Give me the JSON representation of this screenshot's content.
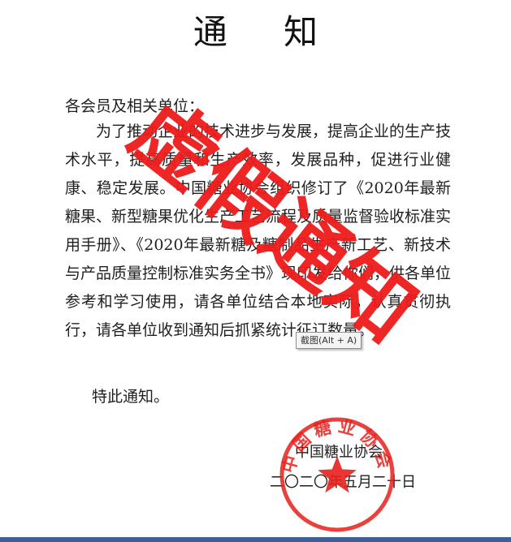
{
  "document": {
    "title": "通 知",
    "salutation": "各会员及相关单位：",
    "body": "为了推动企业的技术进步与发展，提高企业的生产技术水平，提高质量和生产效率，发展品种，促进行业健康、稳定发展。中国糖业协会组织修订了《2020年最新糖果、新型糖果优化生产工艺流程及质量监督验收标准实用手册》、《2020年最新糖及糖制品生产新工艺、新技术与产品质量控制标准实务全书》现印发给你们，供各单位参考和学习使用，请各单位结合本地实际，认真贯彻执行，请各单位收到通知后抓紧统计征订数量。",
    "closing": "特此通知。",
    "organization": "中国糖业协会",
    "date": "二〇二〇年五月二十日"
  },
  "watermark": {
    "text": "虚假通知",
    "color": "#ee1b1b"
  },
  "seal": {
    "text": "中国糖业协会",
    "color": "#e8201c",
    "icon": "star-icon"
  },
  "tooltip": {
    "text": "截图(Alt + A)"
  }
}
